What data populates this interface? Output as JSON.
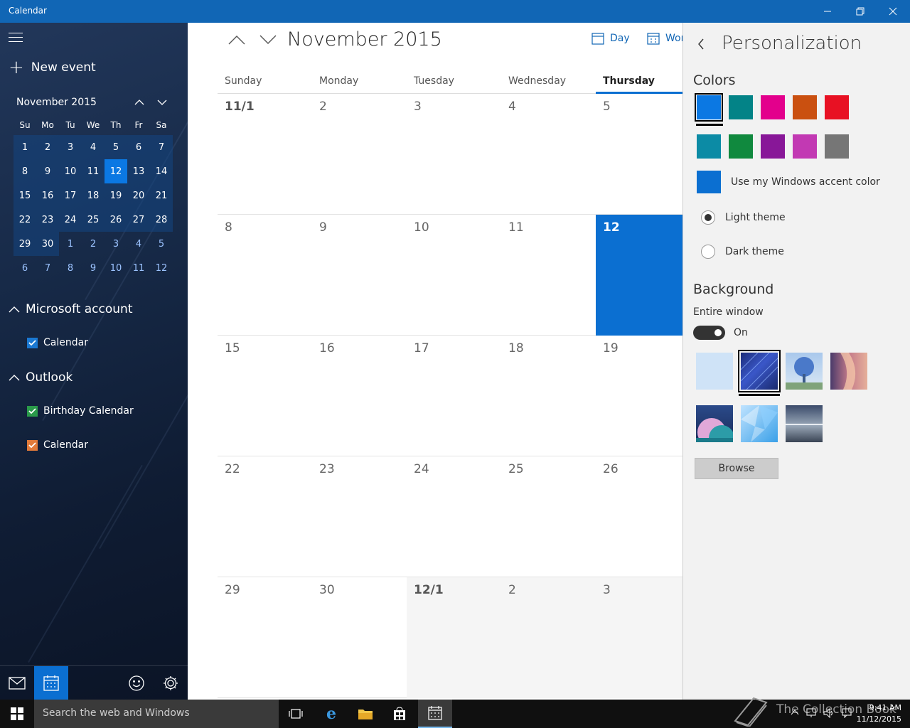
{
  "window": {
    "title": "Calendar"
  },
  "sidebar": {
    "new_event_label": "New event",
    "mini_calendar": {
      "header": "November 2015",
      "dow": [
        "Su",
        "Mo",
        "Tu",
        "We",
        "Th",
        "Fr",
        "Sa"
      ],
      "weeks": [
        [
          "1",
          "2",
          "3",
          "4",
          "5",
          "6",
          "7"
        ],
        [
          "8",
          "9",
          "10",
          "11",
          "12",
          "13",
          "14"
        ],
        [
          "15",
          "16",
          "17",
          "18",
          "19",
          "20",
          "21"
        ],
        [
          "22",
          "23",
          "24",
          "25",
          "26",
          "27",
          "28"
        ],
        [
          "29",
          "30",
          "1",
          "2",
          "3",
          "4",
          "5"
        ],
        [
          "6",
          "7",
          "8",
          "9",
          "10",
          "11",
          "12"
        ]
      ],
      "today": "12"
    },
    "accounts": [
      {
        "name": "Microsoft account",
        "calendars": [
          {
            "label": "Calendar",
            "color": "#1a78d2"
          }
        ]
      },
      {
        "name": "Outlook",
        "calendars": [
          {
            "label": "Birthday Calendar",
            "color": "#2a9a4a"
          },
          {
            "label": "Calendar",
            "color": "#e07a3a"
          }
        ]
      }
    ]
  },
  "main": {
    "month_title": "November 2015",
    "view_buttons": [
      {
        "label": "Day"
      },
      {
        "label": "Wor"
      }
    ],
    "weekdays": [
      "Sunday",
      "Monday",
      "Tuesday",
      "Wednesday",
      "Thursday"
    ],
    "weeks": [
      [
        "11/1",
        "2",
        "3",
        "4",
        "5"
      ],
      [
        "8",
        "9",
        "10",
        "11",
        "12"
      ],
      [
        "15",
        "16",
        "17",
        "18",
        "19"
      ],
      [
        "22",
        "23",
        "24",
        "25",
        "26"
      ],
      [
        "29",
        "30",
        "12/1",
        "2",
        "3"
      ]
    ],
    "today_label": "12",
    "accent": "#0b6fd1"
  },
  "panel": {
    "title": "Personalization",
    "colors_heading": "Colors",
    "swatches": [
      "#0b78e3",
      "#038387",
      "#e3008c",
      "#ca5010",
      "#e81123",
      "#0c8ba5",
      "#10893e",
      "#881798",
      "#c239b3",
      "#767676"
    ],
    "use_accent_label": "Use my Windows accent color",
    "themes": [
      {
        "label": "Light theme",
        "selected": true
      },
      {
        "label": "Dark theme",
        "selected": false
      }
    ],
    "background_heading": "Background",
    "entire_window_label": "Entire window",
    "toggle_state": "On",
    "browse_label": "Browse"
  },
  "taskbar": {
    "search_placeholder": "Search the web and Windows",
    "time": "9:41 AM",
    "date": "11/12/2015",
    "watermark": "The Collection Book"
  }
}
